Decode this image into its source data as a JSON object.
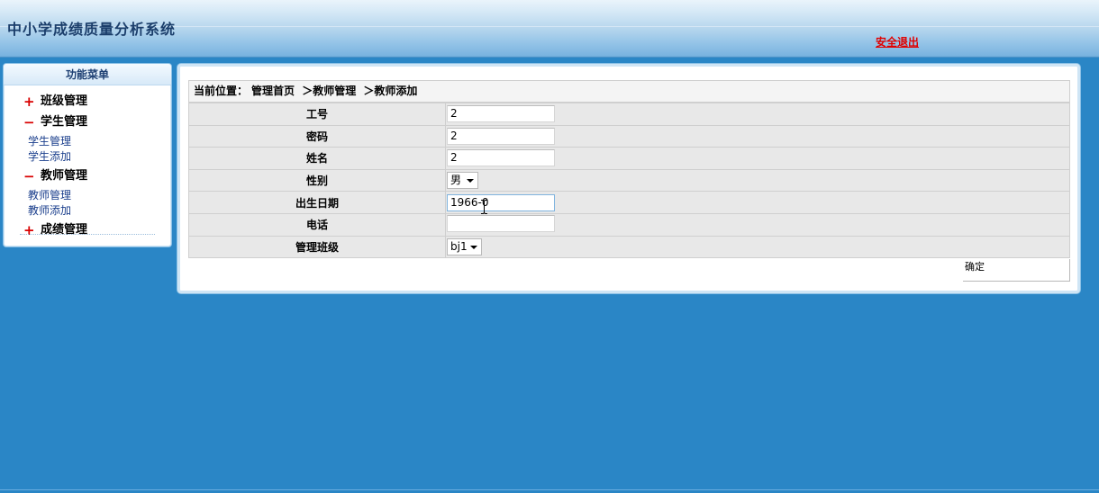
{
  "app": {
    "title": "中小学成绩质量分析系统",
    "logout_label": "安全退出"
  },
  "menu": {
    "header": "功能菜单",
    "groups": [
      {
        "symbol": "+",
        "label": "班级管理",
        "expanded": false,
        "items": []
      },
      {
        "symbol": "−",
        "label": "学生管理",
        "expanded": true,
        "items": [
          "学生管理",
          "学生添加"
        ]
      },
      {
        "symbol": "−",
        "label": "教师管理",
        "expanded": true,
        "items": [
          "教师管理",
          "教师添加"
        ]
      },
      {
        "symbol": "+",
        "label": "成绩管理",
        "expanded": false,
        "items": []
      }
    ]
  },
  "breadcrumb": {
    "prefix": "当前位置：",
    "items": [
      "管理首页",
      "＞教师管理",
      "＞教师添加"
    ]
  },
  "form": {
    "fields": [
      {
        "label": "工号",
        "value": "2",
        "type": "text"
      },
      {
        "label": "密码",
        "value": "2",
        "type": "text"
      },
      {
        "label": "姓名",
        "value": "2",
        "type": "text"
      },
      {
        "label": "性别",
        "value": "男",
        "type": "select"
      },
      {
        "label": "出生日期",
        "value": "1966-0",
        "type": "text"
      },
      {
        "label": "电话",
        "value": "",
        "type": "text"
      },
      {
        "label": "管理班级",
        "value": "bj1",
        "type": "select"
      }
    ],
    "submit_label": "确定"
  },
  "colors": {
    "background": "#2a86c6",
    "logout": "#e00000",
    "menu_symbol": "#d90000"
  }
}
